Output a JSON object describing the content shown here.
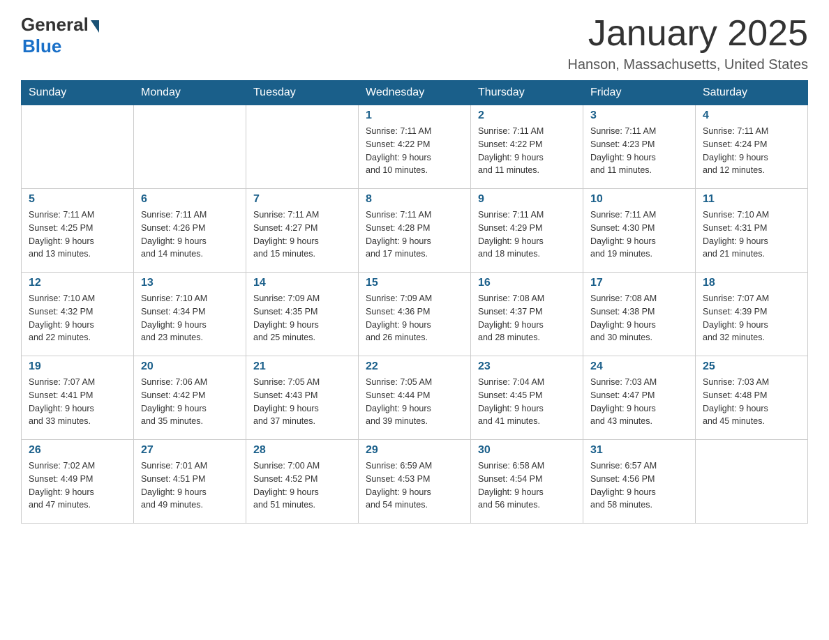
{
  "header": {
    "logo_general": "General",
    "logo_blue": "Blue",
    "month_title": "January 2025",
    "location": "Hanson, Massachusetts, United States"
  },
  "weekdays": [
    "Sunday",
    "Monday",
    "Tuesday",
    "Wednesday",
    "Thursday",
    "Friday",
    "Saturday"
  ],
  "weeks": [
    [
      {
        "day": "",
        "info": ""
      },
      {
        "day": "",
        "info": ""
      },
      {
        "day": "",
        "info": ""
      },
      {
        "day": "1",
        "info": "Sunrise: 7:11 AM\nSunset: 4:22 PM\nDaylight: 9 hours\nand 10 minutes."
      },
      {
        "day": "2",
        "info": "Sunrise: 7:11 AM\nSunset: 4:22 PM\nDaylight: 9 hours\nand 11 minutes."
      },
      {
        "day": "3",
        "info": "Sunrise: 7:11 AM\nSunset: 4:23 PM\nDaylight: 9 hours\nand 11 minutes."
      },
      {
        "day": "4",
        "info": "Sunrise: 7:11 AM\nSunset: 4:24 PM\nDaylight: 9 hours\nand 12 minutes."
      }
    ],
    [
      {
        "day": "5",
        "info": "Sunrise: 7:11 AM\nSunset: 4:25 PM\nDaylight: 9 hours\nand 13 minutes."
      },
      {
        "day": "6",
        "info": "Sunrise: 7:11 AM\nSunset: 4:26 PM\nDaylight: 9 hours\nand 14 minutes."
      },
      {
        "day": "7",
        "info": "Sunrise: 7:11 AM\nSunset: 4:27 PM\nDaylight: 9 hours\nand 15 minutes."
      },
      {
        "day": "8",
        "info": "Sunrise: 7:11 AM\nSunset: 4:28 PM\nDaylight: 9 hours\nand 17 minutes."
      },
      {
        "day": "9",
        "info": "Sunrise: 7:11 AM\nSunset: 4:29 PM\nDaylight: 9 hours\nand 18 minutes."
      },
      {
        "day": "10",
        "info": "Sunrise: 7:11 AM\nSunset: 4:30 PM\nDaylight: 9 hours\nand 19 minutes."
      },
      {
        "day": "11",
        "info": "Sunrise: 7:10 AM\nSunset: 4:31 PM\nDaylight: 9 hours\nand 21 minutes."
      }
    ],
    [
      {
        "day": "12",
        "info": "Sunrise: 7:10 AM\nSunset: 4:32 PM\nDaylight: 9 hours\nand 22 minutes."
      },
      {
        "day": "13",
        "info": "Sunrise: 7:10 AM\nSunset: 4:34 PM\nDaylight: 9 hours\nand 23 minutes."
      },
      {
        "day": "14",
        "info": "Sunrise: 7:09 AM\nSunset: 4:35 PM\nDaylight: 9 hours\nand 25 minutes."
      },
      {
        "day": "15",
        "info": "Sunrise: 7:09 AM\nSunset: 4:36 PM\nDaylight: 9 hours\nand 26 minutes."
      },
      {
        "day": "16",
        "info": "Sunrise: 7:08 AM\nSunset: 4:37 PM\nDaylight: 9 hours\nand 28 minutes."
      },
      {
        "day": "17",
        "info": "Sunrise: 7:08 AM\nSunset: 4:38 PM\nDaylight: 9 hours\nand 30 minutes."
      },
      {
        "day": "18",
        "info": "Sunrise: 7:07 AM\nSunset: 4:39 PM\nDaylight: 9 hours\nand 32 minutes."
      }
    ],
    [
      {
        "day": "19",
        "info": "Sunrise: 7:07 AM\nSunset: 4:41 PM\nDaylight: 9 hours\nand 33 minutes."
      },
      {
        "day": "20",
        "info": "Sunrise: 7:06 AM\nSunset: 4:42 PM\nDaylight: 9 hours\nand 35 minutes."
      },
      {
        "day": "21",
        "info": "Sunrise: 7:05 AM\nSunset: 4:43 PM\nDaylight: 9 hours\nand 37 minutes."
      },
      {
        "day": "22",
        "info": "Sunrise: 7:05 AM\nSunset: 4:44 PM\nDaylight: 9 hours\nand 39 minutes."
      },
      {
        "day": "23",
        "info": "Sunrise: 7:04 AM\nSunset: 4:45 PM\nDaylight: 9 hours\nand 41 minutes."
      },
      {
        "day": "24",
        "info": "Sunrise: 7:03 AM\nSunset: 4:47 PM\nDaylight: 9 hours\nand 43 minutes."
      },
      {
        "day": "25",
        "info": "Sunrise: 7:03 AM\nSunset: 4:48 PM\nDaylight: 9 hours\nand 45 minutes."
      }
    ],
    [
      {
        "day": "26",
        "info": "Sunrise: 7:02 AM\nSunset: 4:49 PM\nDaylight: 9 hours\nand 47 minutes."
      },
      {
        "day": "27",
        "info": "Sunrise: 7:01 AM\nSunset: 4:51 PM\nDaylight: 9 hours\nand 49 minutes."
      },
      {
        "day": "28",
        "info": "Sunrise: 7:00 AM\nSunset: 4:52 PM\nDaylight: 9 hours\nand 51 minutes."
      },
      {
        "day": "29",
        "info": "Sunrise: 6:59 AM\nSunset: 4:53 PM\nDaylight: 9 hours\nand 54 minutes."
      },
      {
        "day": "30",
        "info": "Sunrise: 6:58 AM\nSunset: 4:54 PM\nDaylight: 9 hours\nand 56 minutes."
      },
      {
        "day": "31",
        "info": "Sunrise: 6:57 AM\nSunset: 4:56 PM\nDaylight: 9 hours\nand 58 minutes."
      },
      {
        "day": "",
        "info": ""
      }
    ]
  ]
}
